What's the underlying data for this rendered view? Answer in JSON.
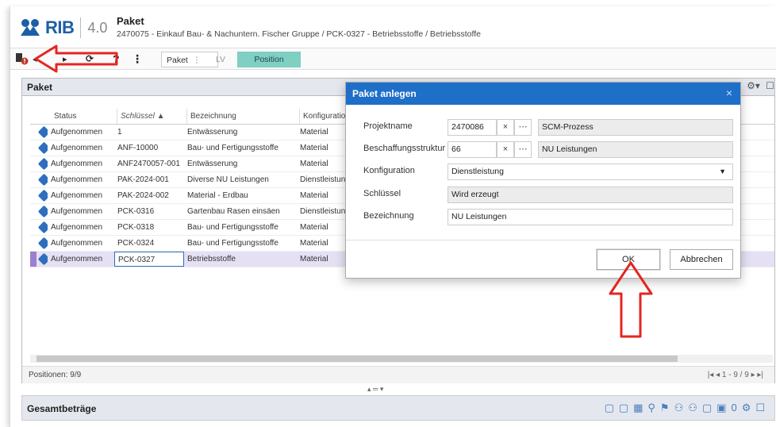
{
  "header": {
    "logo_text": "RIB",
    "version": "4.0",
    "title": "Paket",
    "path": "2470075 - Einkauf Bau- & Nachuntern. Fischer Gruppe / PCK-0327 - Betriebsstoffe / Betriebsstoffe"
  },
  "toolbar": {
    "tab_paket": "Paket",
    "tab_lv": "LV",
    "tab_position": "Position",
    "help": "?",
    "menu": "⋮"
  },
  "panel": {
    "title": "Paket",
    "columns": [
      "Status",
      "Schlüssel ▲",
      "Bezeichnung",
      "Konfiguration"
    ],
    "rows": [
      {
        "status": "Aufgenommen",
        "key": "1",
        "name": "Entwässerung",
        "config": "Material"
      },
      {
        "status": "Aufgenommen",
        "key": "ANF-10000",
        "name": "Bau- und Fertigungsstoffe",
        "config": "Material"
      },
      {
        "status": "Aufgenommen",
        "key": "ANF2470057-001",
        "name": "Entwässerung",
        "config": "Material"
      },
      {
        "status": "Aufgenommen",
        "key": "PAK-2024-001",
        "name": "Diverse NU Leistungen",
        "config": "Dienstleistung"
      },
      {
        "status": "Aufgenommen",
        "key": "PAK-2024-002",
        "name": "Material - Erdbau",
        "config": "Material"
      },
      {
        "status": "Aufgenommen",
        "key": "PCK-0316",
        "name": "Gartenbau Rasen einsäen",
        "config": "Dienstleistung"
      },
      {
        "status": "Aufgenommen",
        "key": "PCK-0318",
        "name": "Bau- und Fertigungsstoffe",
        "config": "Material"
      },
      {
        "status": "Aufgenommen",
        "key": "PCK-0324",
        "name": "Bau- und Fertigungsstoffe",
        "config": "Material"
      },
      {
        "status": "Aufgenommen",
        "key": "PCK-0327",
        "name": "Betriebsstoffe",
        "config": "Material",
        "selected": true
      }
    ],
    "status_left": "Positionen: 9/9",
    "status_right": "1 - 9 / 9"
  },
  "bottom": {
    "title": "Gesamtbeträge"
  },
  "dialog": {
    "title": "Paket anlegen",
    "close": "×",
    "fields": {
      "projektname_label": "Projektname",
      "projektname_value": "2470086",
      "projektname_desc": "SCM-Prozess",
      "beschaffung_label": "Beschaffungsstruktur",
      "beschaffung_value": "66",
      "beschaffung_desc": "NU Leistungen",
      "konfiguration_label": "Konfiguration",
      "konfiguration_value": "Dienstleistung",
      "schluessel_label": "Schlüssel",
      "schluessel_value": "Wird erzeugt",
      "bezeichnung_label": "Bezeichnung",
      "bezeichnung_value": "NU Leistungen"
    },
    "ok": "OK",
    "cancel": "Abbrechen"
  }
}
